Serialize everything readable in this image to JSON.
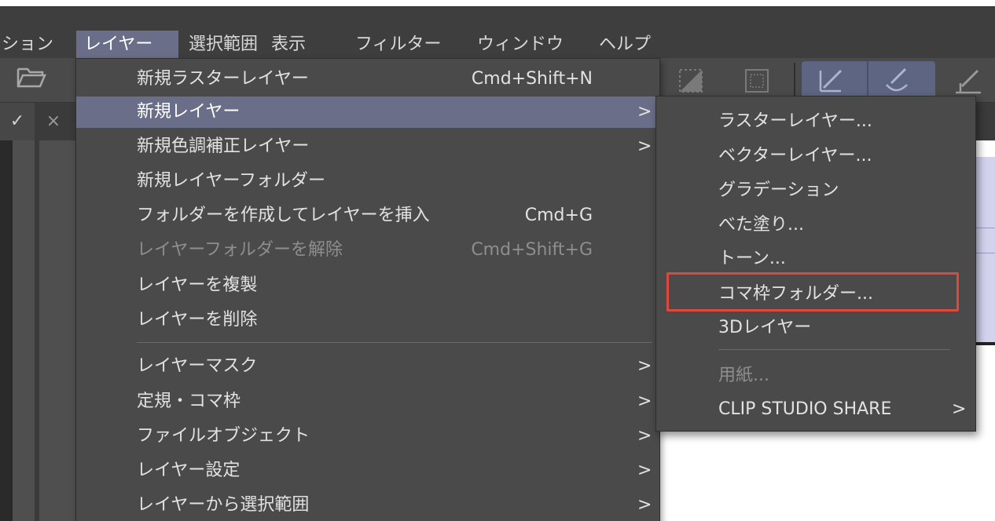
{
  "menubar": {
    "items": [
      {
        "label": "ション"
      },
      {
        "label": "レイヤー"
      },
      {
        "label": "選択範囲"
      },
      {
        "label": "表示"
      },
      {
        "label": "フィルター"
      },
      {
        "label": "ウィンドウ"
      },
      {
        "label": "ヘルプ"
      }
    ],
    "active_index": 1
  },
  "tabs": {
    "check_glyph": "✓",
    "close_glyph": "×"
  },
  "layer_menu": {
    "items": [
      {
        "label": "新規ラスターレイヤー",
        "shortcut": "Cmd+Shift+N"
      },
      {
        "label": "新規レイヤー",
        "submenu": true,
        "highlighted": true
      },
      {
        "label": "新規色調補正レイヤー",
        "submenu": true
      },
      {
        "label": "新規レイヤーフォルダー"
      },
      {
        "label": "フォルダーを作成してレイヤーを挿入",
        "shortcut": "Cmd+G"
      },
      {
        "label": "レイヤーフォルダーを解除",
        "shortcut": "Cmd+Shift+G",
        "disabled": true
      },
      {
        "label": "レイヤーを複製"
      },
      {
        "label": "レイヤーを削除"
      },
      {
        "label": "レイヤーマスク",
        "submenu": true
      },
      {
        "label": "定規・コマ枠",
        "submenu": true
      },
      {
        "label": "ファイルオブジェクト",
        "submenu": true
      },
      {
        "label": "レイヤー設定",
        "submenu": true
      },
      {
        "label": "レイヤーから選択範囲",
        "submenu": true
      }
    ]
  },
  "new_layer_submenu": {
    "items": [
      {
        "label": "ラスターレイヤー..."
      },
      {
        "label": "ベクターレイヤー..."
      },
      {
        "label": "グラデーション"
      },
      {
        "label": "べた塗り..."
      },
      {
        "label": "トーン..."
      },
      {
        "label": "コマ枠フォルダー...",
        "outlined": true
      },
      {
        "label": "3Dレイヤー"
      },
      {
        "label": "用紙...",
        "disabled": true
      },
      {
        "label": "CLIP STUDIO SHARE",
        "submenu": true
      }
    ]
  },
  "arrow_glyph": ">",
  "colors": {
    "menu_bg": "#4a4a4a",
    "highlight": "#6a6e88",
    "outline_red": "#e0483c"
  }
}
